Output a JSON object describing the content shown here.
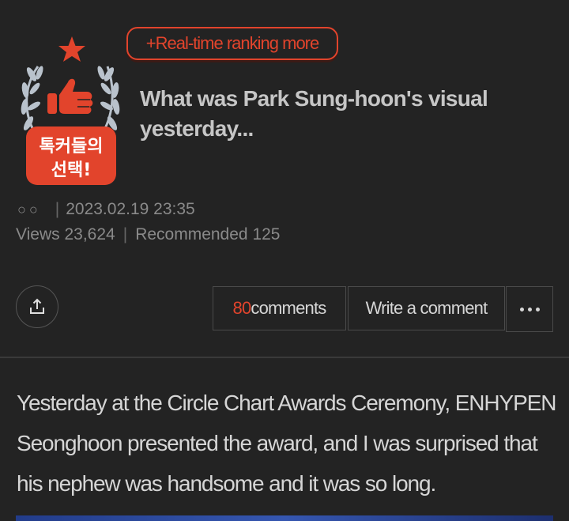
{
  "header": {
    "ranking_button": "+Real-time ranking more",
    "badge_text_line1": "톡커들의",
    "badge_text_line2": "선택!"
  },
  "post": {
    "title": "What was Park Sung-hoon's visual yesterday...",
    "author": "○○",
    "date": "2023.02.19 23:35",
    "views_label": "Views",
    "views": "23,624",
    "recommended_label": "Recommended",
    "recommended": "125",
    "body": "Yesterday at the Circle Chart Awards Ceremony, ENHYPEN Seonghoon presented the award, and I was surprised that his nephew was handsome and it was so long."
  },
  "actions": {
    "comment_count": "80",
    "comments_label": "comments",
    "write_comment": "Write a comment"
  },
  "colors": {
    "accent": "#e2442c",
    "background": "#232323"
  },
  "icons": [
    "trophy-badge-icon",
    "share-icon",
    "more-icon"
  ]
}
